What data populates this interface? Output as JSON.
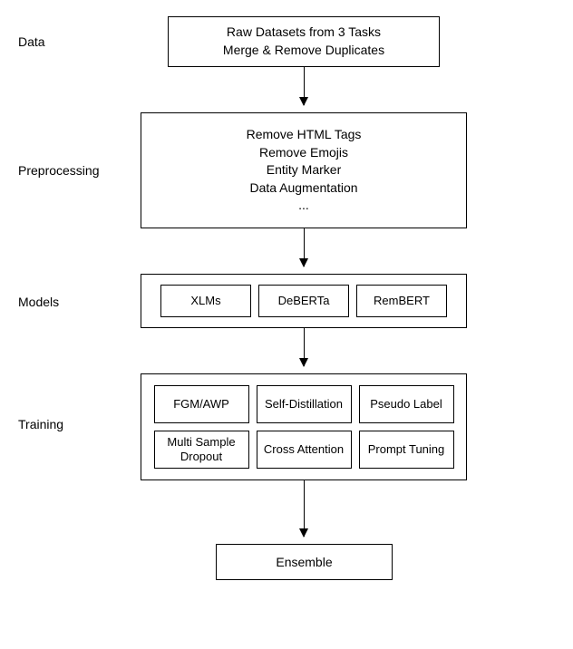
{
  "stages": {
    "data": {
      "label": "Data",
      "box_lines": [
        "Raw Datasets from 3 Tasks",
        "Merge & Remove Duplicates"
      ]
    },
    "preprocessing": {
      "label": "Preprocessing",
      "box_lines": [
        "Remove HTML Tags",
        "Remove Emojis",
        "Entity Marker",
        "Data Augmentation",
        "..."
      ]
    },
    "models": {
      "label": "Models",
      "items": [
        "XLMs",
        "DeBERTa",
        "RemBERT"
      ]
    },
    "training": {
      "label": "Training",
      "items": [
        "FGM/AWP",
        "Self-Distillation",
        "Pseudo Label",
        "Multi Sample\nDropout",
        "Cross Attention",
        "Prompt Tuning"
      ]
    },
    "ensemble": {
      "label": "Ensemble"
    }
  }
}
